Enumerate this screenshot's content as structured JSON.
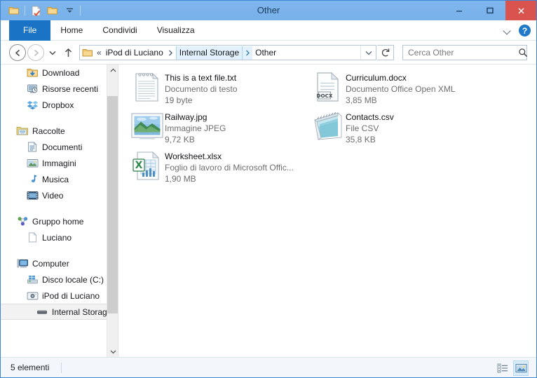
{
  "window": {
    "title": "Other",
    "quick_access": [
      {
        "name": "folder-icon",
        "label": "Proprietà cartella"
      },
      {
        "name": "new-folder-icon",
        "label": "Nuova cartella"
      },
      {
        "name": "folder-open-icon",
        "label": "Cartella"
      },
      {
        "name": "customize-dropdown-icon",
        "label": "Personalizza barra di accesso rapido"
      }
    ],
    "controls": {
      "minimize": "—",
      "maximize": "▢",
      "close": "✕",
      "close_color": "#d9534f"
    }
  },
  "ribbon": {
    "tabs": [
      {
        "label": "File",
        "active": true
      },
      {
        "label": "Home",
        "active": false
      },
      {
        "label": "Condividi",
        "active": false
      },
      {
        "label": "Visualizza",
        "active": false
      }
    ],
    "expand_icon": "chevron-down-icon",
    "help_label": "?"
  },
  "navigation": {
    "back_label": "Indietro",
    "forward_label": "Avanti",
    "history_label": "Percorsi recenti",
    "up_label": "Su",
    "breadcrumbs": [
      {
        "label": "«",
        "type": "overflow"
      },
      {
        "label": "iPod di Luciano",
        "selected": false
      },
      {
        "label": "Internal Storage",
        "selected": true
      },
      {
        "label": "Other",
        "selected": false
      }
    ],
    "dropdown_icon": "chevron-down-icon",
    "refresh_icon": "refresh-icon",
    "search": {
      "placeholder": "Cerca Other",
      "value": "",
      "icon": "search-icon"
    }
  },
  "sidebar": {
    "items": [
      {
        "label": "Download",
        "icon": "download-folder-icon",
        "level": 1,
        "selected": false
      },
      {
        "label": "Risorse recenti",
        "icon": "recent-places-icon",
        "level": 1,
        "selected": false
      },
      {
        "label": "Dropbox",
        "icon": "dropbox-icon",
        "level": 1,
        "selected": false
      },
      {
        "label": "",
        "icon": "",
        "level": 0,
        "selected": false,
        "spacer": true
      },
      {
        "label": "Raccolte",
        "icon": "libraries-icon",
        "level": 0,
        "selected": false
      },
      {
        "label": "Documenti",
        "icon": "documents-icon",
        "level": 1,
        "selected": false
      },
      {
        "label": "Immagini",
        "icon": "pictures-icon",
        "level": 1,
        "selected": false
      },
      {
        "label": "Musica",
        "icon": "music-icon",
        "level": 1,
        "selected": false
      },
      {
        "label": "Video",
        "icon": "video-icon",
        "level": 1,
        "selected": false
      },
      {
        "label": "",
        "icon": "",
        "level": 0,
        "selected": false,
        "spacer": true
      },
      {
        "label": "Gruppo home",
        "icon": "homegroup-icon",
        "level": 0,
        "selected": false
      },
      {
        "label": "Luciano",
        "icon": "user-page-icon",
        "level": 1,
        "selected": false
      },
      {
        "label": "",
        "icon": "",
        "level": 0,
        "selected": false,
        "spacer": true
      },
      {
        "label": "Computer",
        "icon": "computer-icon",
        "level": 0,
        "selected": false
      },
      {
        "label": "Disco locale (C:)",
        "icon": "local-disk-icon",
        "level": 1,
        "selected": false
      },
      {
        "label": "iPod di Luciano",
        "icon": "ipod-camera-icon",
        "level": 1,
        "selected": false
      },
      {
        "label": "Internal Storage",
        "icon": "internal-storage-icon",
        "level": 2,
        "selected": true
      }
    ],
    "scrollbar": {
      "up": "▲",
      "down": "▼"
    }
  },
  "files": {
    "columns": [
      [
        {
          "name": "This is a text file.txt",
          "type": "Documento di testo",
          "size": "19 byte",
          "icon": "text-file-icon"
        },
        {
          "name": "Railway.jpg",
          "type": "Immagine JPEG",
          "size": "9,72 KB",
          "icon": "jpeg-thumbnail-icon"
        },
        {
          "name": "Worksheet.xlsx",
          "type": "Foglio di lavoro di Microsoft Offic...",
          "size": "1,90 MB",
          "icon": "excel-file-icon"
        }
      ],
      [
        {
          "name": "Curriculum.docx",
          "type": "Documento Office Open XML",
          "size": "3,85 MB",
          "icon": "docx-file-icon"
        },
        {
          "name": "Contacts.csv",
          "type": "File CSV",
          "size": "35,8 KB",
          "icon": "csv-file-icon"
        }
      ]
    ]
  },
  "statusbar": {
    "item_count": "5 elementi",
    "views": [
      {
        "name": "details-view-button",
        "label": "Visualizzazione dettagli",
        "active": false
      },
      {
        "name": "large-icons-view-button",
        "label": "Visualizzazione icone grandi",
        "active": true
      }
    ]
  },
  "colors": {
    "window_frame": "#73aeea",
    "accent": "#1a73c4",
    "close_red": "#d9534f",
    "selection": "#f2f2f2"
  }
}
